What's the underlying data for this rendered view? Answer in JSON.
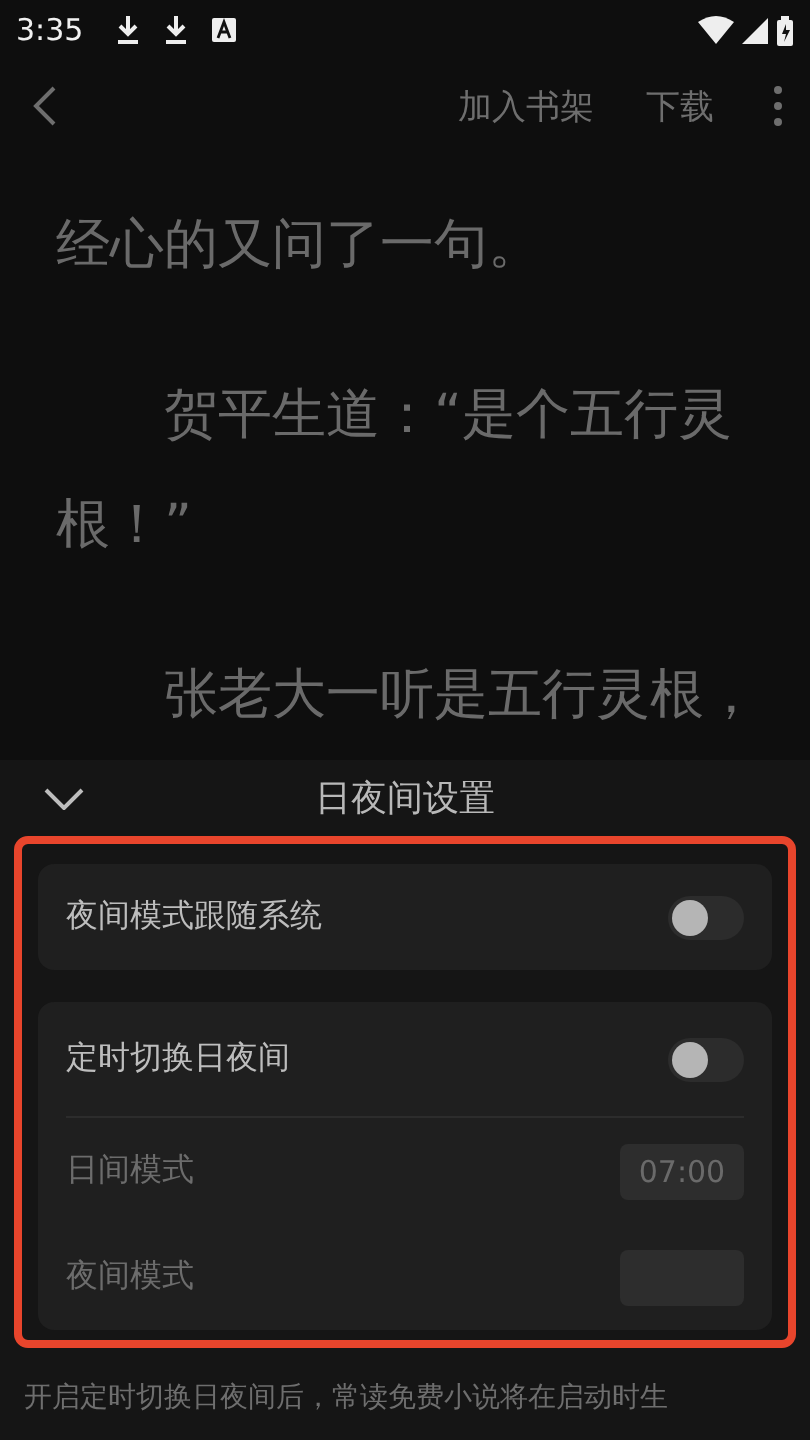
{
  "status_bar": {
    "time": "3:35"
  },
  "toolbar": {
    "actions": [
      "加入书架",
      "下载"
    ]
  },
  "reader": {
    "paragraphs": [
      {
        "text": "经心的又问了一句。",
        "indented": false
      },
      {
        "text": "贺平生道：“是个五行灵根！”",
        "indented": true
      },
      {
        "text": "张老大一听是五行灵根，",
        "indented": true
      }
    ]
  },
  "settings_panel": {
    "title": "日夜间设置",
    "highlighted": true,
    "cards": [
      {
        "rows": [
          {
            "kind": "toggle",
            "label": "夜间模式跟随系统",
            "on": false
          }
        ]
      },
      {
        "rows": [
          {
            "kind": "toggle",
            "label": "定时切换日夜间",
            "on": false
          },
          {
            "kind": "time",
            "label": "日间模式",
            "value": "07:00"
          },
          {
            "kind": "time",
            "label": "夜间模式"
          }
        ]
      }
    ],
    "note": "开启定时切换日夜间后，常读免费小说将在启动时生"
  }
}
